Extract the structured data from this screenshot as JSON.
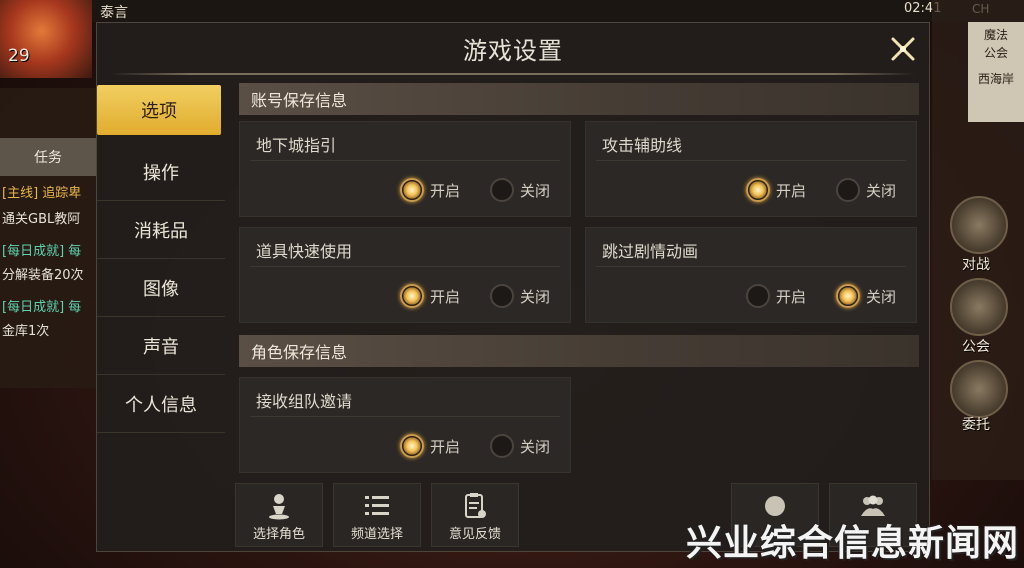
{
  "hud": {
    "player_name": "泰言",
    "clock": "02:41",
    "signal": "CH",
    "level": "29",
    "task_tab": "任务",
    "quests": [
      {
        "text": "[主线] 追踪卑",
        "kind": "hl"
      },
      {
        "text": "通关GBL教阿",
        "kind": "plain"
      },
      {
        "text": "[每日成就] 每",
        "kind": "daily"
      },
      {
        "text": "分解装备20次",
        "kind": "plain"
      },
      {
        "text": "[每日成就] 每",
        "kind": "daily"
      },
      {
        "text": "金库1次",
        "kind": "plain"
      }
    ],
    "right_menu": {
      "sign": [
        "魔法",
        "公会"
      ],
      "sign_sub": "西海岸",
      "battle": "对战",
      "guild": "公会",
      "commission": "委托"
    }
  },
  "modal": {
    "title": "游戏设置",
    "nav": [
      {
        "label": "选项",
        "active": true
      },
      {
        "label": "操作",
        "active": false
      },
      {
        "label": "消耗品",
        "active": false
      },
      {
        "label": "图像",
        "active": false
      },
      {
        "label": "声音",
        "active": false
      },
      {
        "label": "个人信息",
        "active": false
      }
    ],
    "account_section": "账号保存信息",
    "character_section": "角色保存信息",
    "option_on": "开启",
    "option_off": "关闭",
    "settings": [
      {
        "label": "地下城指引",
        "value": "on"
      },
      {
        "label": "攻击辅助线",
        "value": "on"
      },
      {
        "label": "道具快速使用",
        "value": "on"
      },
      {
        "label": "跳过剧情动画",
        "value": "off"
      },
      {
        "label": "接收组队邀请",
        "value": "on"
      }
    ],
    "bottom_buttons": [
      {
        "label": "选择角色",
        "icon": "character-select-icon"
      },
      {
        "label": "频道选择",
        "icon": "channel-list-icon"
      },
      {
        "label": "意见反馈",
        "icon": "feedback-clipboard-icon"
      }
    ]
  },
  "watermark": "兴业综合信息新闻网",
  "colors": {
    "accent_gold": "#e9b941",
    "panel_bg": "#2c2825",
    "text_light": "#dedacd"
  }
}
